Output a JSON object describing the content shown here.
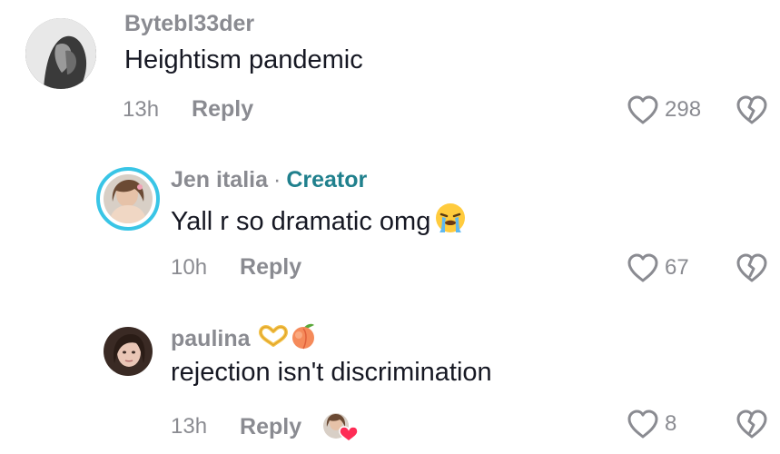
{
  "comments": [
    {
      "username": "Bytebl33der",
      "text": "Heightism pandemic",
      "time": "13h",
      "reply_label": "Reply",
      "likes": "298"
    },
    {
      "username": "Jen italia",
      "separator": "·",
      "creator_label": "Creator",
      "text": "Yall r so dramatic omg",
      "time": "10h",
      "reply_label": "Reply",
      "likes": "67"
    },
    {
      "username": "paulina",
      "text": "rejection isn't discrimination",
      "time": "13h",
      "reply_label": "Reply",
      "likes": "8"
    }
  ],
  "icons": {
    "like": "heart-outline-icon",
    "dislike": "broken-heart-icon",
    "emoji_cry": "loudly-crying-face-icon",
    "emoji_hands": "heart-hands-icon",
    "emoji_peach": "peach-icon",
    "creator_liked": "creator-liked-heart-icon"
  },
  "colors": {
    "text_primary": "#161823",
    "text_secondary": "#8a8b91",
    "creator": "#20808d",
    "story_ring": "#39c5e6",
    "liked_heart": "#fe2c55"
  }
}
